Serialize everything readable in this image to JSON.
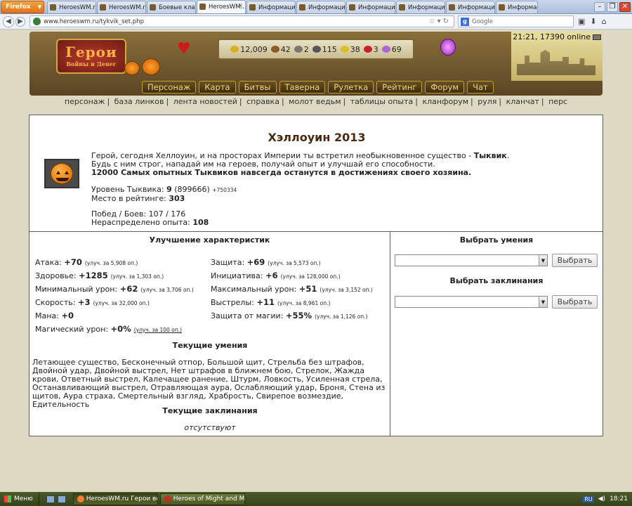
{
  "browser": {
    "menu_button": "Firefox",
    "tabs": [
      {
        "title": "HeroesWM.ru ..."
      },
      {
        "title": "HeroesWM.ru ..."
      },
      {
        "title": "Боевые клан..."
      },
      {
        "title": "HeroesWM..."
      },
      {
        "title": "Информация..."
      },
      {
        "title": "Информация..."
      },
      {
        "title": "Информация..."
      },
      {
        "title": "Информация..."
      },
      {
        "title": "Информация..."
      },
      {
        "title": "Информация..."
      }
    ],
    "url": "www.heroeswm.ru/tykvik_set.php",
    "search_placeholder": "Google"
  },
  "header": {
    "logo_title": "Герои",
    "logo_subtitle": "Войны и Денег",
    "time_online": "21:21, 17390 online",
    "resources": [
      {
        "name": "gold",
        "value": "12,009",
        "color": "#d9b120"
      },
      {
        "name": "wood",
        "value": "42",
        "color": "#8a5a2b"
      },
      {
        "name": "ore",
        "value": "2",
        "color": "#777777"
      },
      {
        "name": "mercury",
        "value": "115",
        "color": "#555555"
      },
      {
        "name": "sulfur",
        "value": "38",
        "color": "#e0c020"
      },
      {
        "name": "crystals",
        "value": "3",
        "color": "#c8202a"
      },
      {
        "name": "gems",
        "value": "69",
        "color": "#a868d8"
      }
    ],
    "menu": [
      "Персонаж",
      "Карта",
      "Битвы",
      "Таверна",
      "Рулетка",
      "Рейтинг",
      "Форум",
      "Чат"
    ]
  },
  "links": [
    "персонаж",
    "база линков",
    "лента новостей",
    "справка",
    "молот ведьм",
    "таблицы опыта",
    "кланфорум",
    "руля",
    "кланчат",
    "перс"
  ],
  "event": {
    "title": "Хэллоуин 2013",
    "intro_line1_a": "Герой, сегодня Хеллоуин, и на просторах Империи ты встретил необыкновенное существо - ",
    "intro_line1_b": "Тыквик",
    "intro_line1_c": ".",
    "intro_line2": "Будь с ним строг, нападай им на героев, получай опыт и улучшай его способности.",
    "intro_line3": "12000 Самых опытных Тыквиков навсегда останутся в достижениях своего хозяина.",
    "level_label": "Уровень Тыквика: ",
    "level_value": "9",
    "level_exp": "(899666)",
    "level_next": "+750334",
    "rating_label": "Место в рейтинге: ",
    "rating_value": "303",
    "battles_label": "Побед / Боев: ",
    "battles_value": "107 / 176",
    "unspent_label": "Нераспределено опыта: ",
    "unspent_value": "108"
  },
  "characteristics": {
    "heading": "Улучшение характеристик",
    "rows": [
      [
        {
          "label": "Атака: ",
          "value": "+70",
          "improve": "(улуч. за 5,908 оп.)"
        },
        {
          "label": "Защита: ",
          "value": "+69",
          "improve": "(улуч. за 5,573 оп.)"
        }
      ],
      [
        {
          "label": "Здоровье: ",
          "value": "+1285",
          "improve": "(улуч. за 1,303 оп.)"
        },
        {
          "label": "Инициатива: ",
          "value": "+6",
          "improve": "(улуч. за 128,000 оп.)"
        }
      ],
      [
        {
          "label": "Минимальный урон: ",
          "value": "+62",
          "improve": "(улуч. за 3,706 оп.)"
        },
        {
          "label": "Максимальный урон: ",
          "value": "+51",
          "improve": "(улуч. за 3,152 оп.)"
        }
      ],
      [
        {
          "label": "Скорость: ",
          "value": "+3",
          "improve": "(улуч. за 32,000 оп.)"
        },
        {
          "label": "Выстрелы: ",
          "value": "+11",
          "improve": "(улуч. за 8,961 оп.)"
        }
      ],
      [
        {
          "label": "Мана: ",
          "value": "+0",
          "improve": ""
        },
        {
          "label": "Защита от магии: ",
          "value": "+55%",
          "improve": "(улуч. за 1,126 оп.)"
        }
      ],
      [
        {
          "label": "Магический урон: ",
          "value": "+0%",
          "improve": "(улуч. за 100 оп.)"
        },
        {
          "label": "",
          "value": "",
          "improve": ""
        }
      ]
    ]
  },
  "skills": {
    "heading": "Текущие умения",
    "text": "Летающее существо, Бесконечный отпор, Большой щит, Стрельба без штрафов, Двойной удар, Двойной выстрел, Нет штрафов в ближнем бою, Стрелок, Жажда крови, Ответный выстрел, Калечащее ранение, Штурм, Ловкость, Усиленная стрела, Останавливающий выстрел, Отравляющая аура, Ослабляющий удар, Броня, Стена из щитов, Аура страха, Смертельный взгляд, Храбрость, Свирепое возмездие, Едительность"
  },
  "spells": {
    "heading": "Текущие заклинания",
    "none": "отсутствуют"
  },
  "choose": {
    "skills_heading": "Выбрать умения",
    "spells_heading": "Выбрать заклинания",
    "button": "Выбрать"
  },
  "taskbar": {
    "start": "Меню",
    "tasks": [
      "HeroesWM.ru Герои войн",
      "Heroes of Might and Magi"
    ],
    "lang": "RU",
    "clock": "18:21"
  }
}
